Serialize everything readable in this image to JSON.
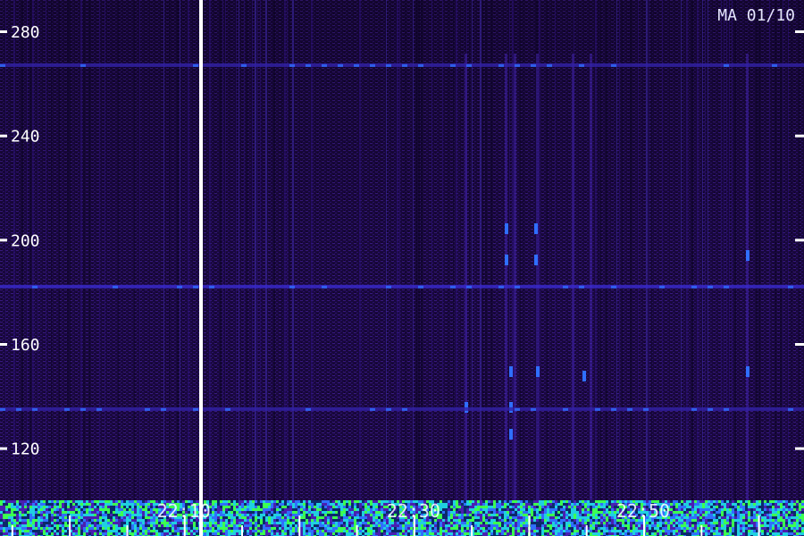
{
  "chart_data": {
    "type": "heatmap",
    "title": "MA 01/10",
    "xlabel": "",
    "ylabel": "",
    "y_ticks": [
      280,
      240,
      200,
      160,
      120
    ],
    "ylim": [
      100,
      292
    ],
    "x_ticks": [
      "22:10",
      "22:30",
      "22:50"
    ],
    "x_time_range": [
      "21:54",
      "23:04"
    ],
    "gap_after": "22:09",
    "bright_bands": [
      182,
      135,
      267
    ],
    "colormap": [
      "#000000",
      "#2a0a55",
      "#4a1fb0",
      "#2f6fff",
      "#20d0e0",
      "#3cff50"
    ]
  }
}
